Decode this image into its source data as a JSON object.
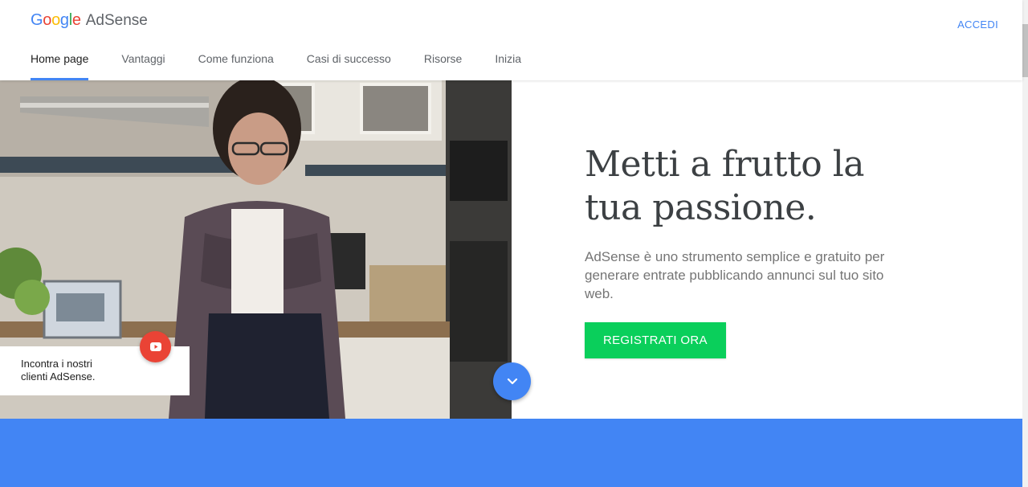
{
  "header": {
    "logo_google": "Google",
    "logo_product": "AdSense",
    "signin_label": "ACCEDI"
  },
  "nav": {
    "items": [
      {
        "label": "Home page"
      },
      {
        "label": "Vantaggi"
      },
      {
        "label": "Come funziona"
      },
      {
        "label": "Casi di successo"
      },
      {
        "label": "Risorse"
      },
      {
        "label": "Inizia"
      }
    ],
    "active_index": 0
  },
  "hero": {
    "headline_line1": "Metti a frutto la",
    "headline_line2": "tua passione.",
    "subtitle": "AdSense è uno strumento semplice e gratuito per generare entrate pubblicando annunci sul tuo sito web.",
    "cta_label": "REGISTRATI ORA",
    "video_card_text": "Incontra i nostri clienti AdSense.",
    "play_icon": "youtube-play-icon",
    "scroll_icon": "chevron-down-icon"
  },
  "colors": {
    "accent_blue": "#4285f4",
    "cta_green": "#0acf5b",
    "play_red": "#ea4335",
    "text_dark": "#3c4043",
    "text_muted": "#757575"
  }
}
